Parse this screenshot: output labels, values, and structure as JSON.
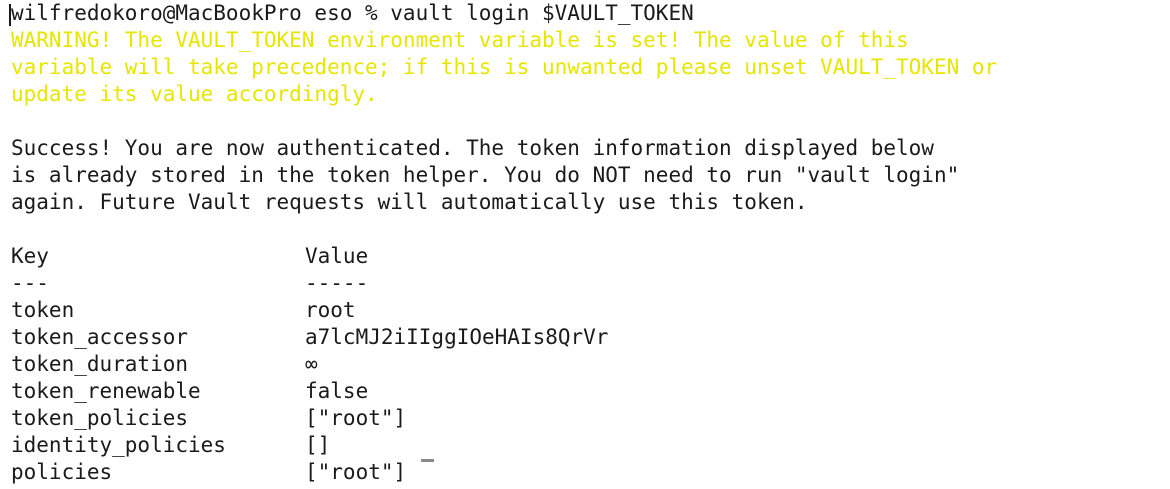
{
  "prompt": "wilfredokoro@MacBookPro eso % vault login $VAULT_TOKEN",
  "warning_lines": [
    "WARNING! The VAULT_TOKEN environment variable is set! The value of this",
    "variable will take precedence; if this is unwanted please unset VAULT_TOKEN or",
    "update its value accordingly."
  ],
  "success_lines": [
    "Success! You are now authenticated. The token information displayed below",
    "is already stored in the token helper. You do NOT need to run \"vault login\"",
    "again. Future Vault requests will automatically use this token."
  ],
  "table": {
    "header_key": "Key",
    "header_value": "Value",
    "sep_key": "---",
    "sep_value": "-----",
    "rows": [
      {
        "key": "token",
        "value": "root"
      },
      {
        "key": "token_accessor",
        "value": "a7lcMJ2iIIggIOeHAIs8QrVr"
      },
      {
        "key": "token_duration",
        "value": "∞"
      },
      {
        "key": "token_renewable",
        "value": "false"
      },
      {
        "key": "token_policies",
        "value": "[\"root\"]"
      },
      {
        "key": "identity_policies",
        "value": "[]"
      },
      {
        "key": "policies",
        "value": "[\"root\"]"
      }
    ]
  },
  "colors": {
    "warning": "#e6e600",
    "text": "#1a1a1a",
    "background": "#ffffff"
  }
}
